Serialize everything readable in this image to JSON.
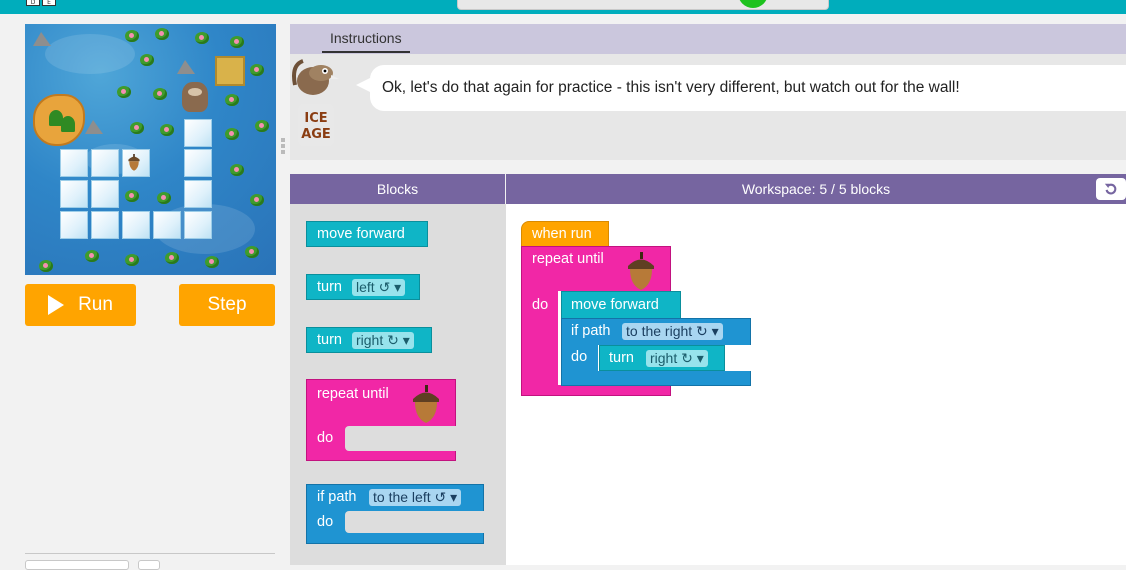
{
  "header": {
    "lang_left": "D",
    "lang_right": "E"
  },
  "controls": {
    "run_label": "Run",
    "step_label": "Step"
  },
  "instructions": {
    "tab_label": "Instructions",
    "text": "Ok, let's do that again for practice - this isn't very different, but watch out for the wall!",
    "logo_text": "ICE AGE"
  },
  "blocks_panel": {
    "title": "Blocks",
    "move_forward": "move forward",
    "turn_left_label": "turn",
    "turn_left_value": "left ↺ ▾",
    "turn_right_label": "turn",
    "turn_right_value": "right ↻ ▾",
    "repeat_until": "repeat until",
    "repeat_do": "do",
    "if_path": "if path",
    "if_path_value": "to the left ↺ ▾",
    "if_do": "do"
  },
  "workspace": {
    "title": "Workspace: 5 / 5 blocks",
    "when_run": "when run",
    "repeat_until": "repeat until",
    "repeat_do": "do",
    "move_forward": "move forward",
    "if_path": "if path",
    "if_path_value": "to the right ↻ ▾",
    "if_do": "do",
    "turn_label": "turn",
    "turn_value": "right ↻ ▾"
  },
  "colors": {
    "top_bar": "#00adbc",
    "run_button": "#ffa400",
    "header_purple": "#7665a0",
    "action_block": "#0fb5c6",
    "loop_block": "#f127a6",
    "logic_block": "#1f94d2",
    "event_block": "#ffa400"
  }
}
